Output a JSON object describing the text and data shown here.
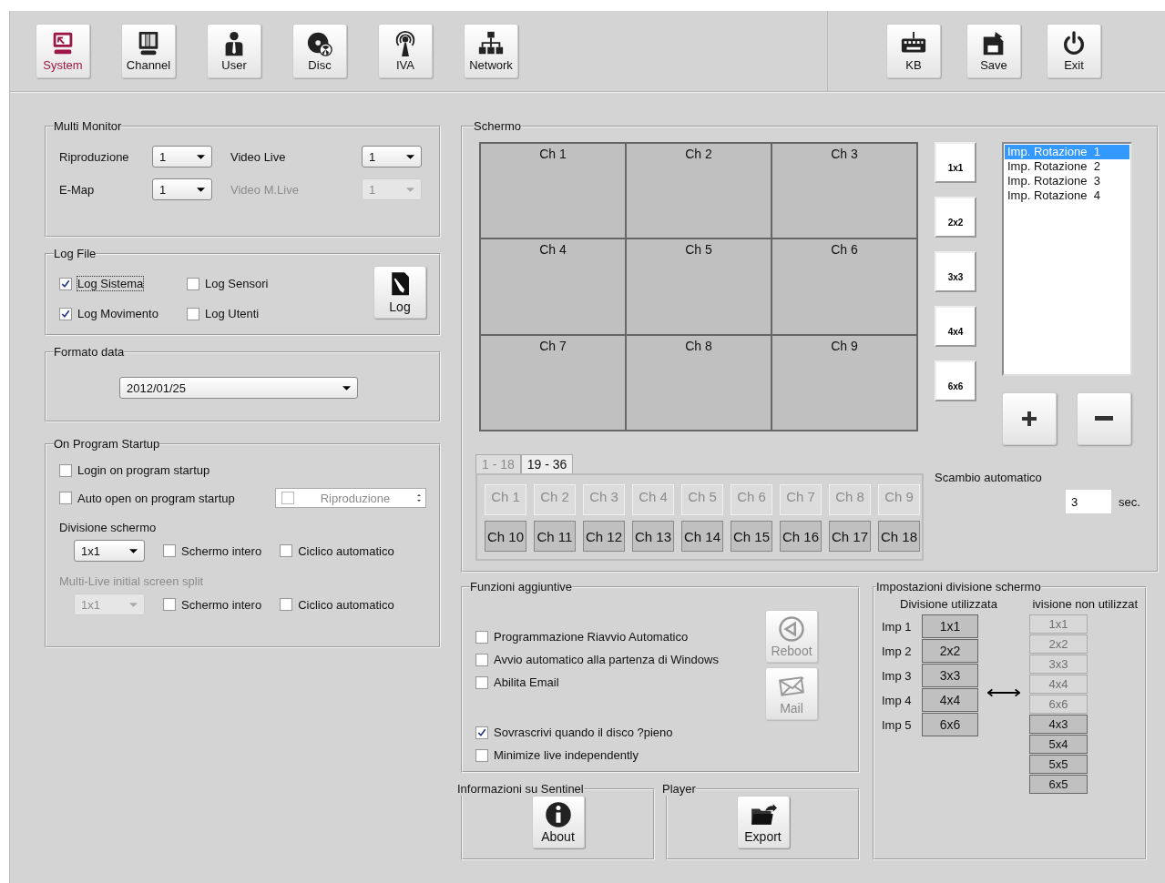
{
  "toolbar": {
    "left": [
      {
        "label": "System",
        "selected": true
      },
      {
        "label": "Channel",
        "selected": false
      },
      {
        "label": "User",
        "selected": false
      },
      {
        "label": "Disc",
        "selected": false
      },
      {
        "label": "IVA",
        "selected": false
      },
      {
        "label": "Network",
        "selected": false
      }
    ],
    "right": [
      {
        "label": "KB"
      },
      {
        "label": "Save"
      },
      {
        "label": "Exit"
      }
    ]
  },
  "multi_monitor": {
    "title": "Multi Monitor",
    "fields": [
      {
        "label": "Riproduzione",
        "value": "1",
        "disabled": false
      },
      {
        "label": "Video Live",
        "value": "1",
        "disabled": false
      },
      {
        "label": "E-Map",
        "value": "1",
        "disabled": false
      },
      {
        "label": "Video M.Live",
        "value": "1",
        "disabled": true
      }
    ]
  },
  "log_file": {
    "title": "Log File",
    "checkboxes": [
      {
        "label": "Log Sistema",
        "checked": true,
        "focused": true
      },
      {
        "label": "Log Sensori",
        "checked": false,
        "focused": false
      },
      {
        "label": "Log Movimento",
        "checked": true,
        "focused": false
      },
      {
        "label": "Log Utenti",
        "checked": false,
        "focused": false
      }
    ],
    "button": "Log"
  },
  "date_format": {
    "title": "Formato data",
    "value": "2012/01/25"
  },
  "startup": {
    "title": "On Program Startup",
    "login": {
      "label": "Login on program startup",
      "checked": false
    },
    "auto_open": {
      "label": "Auto open on program startup",
      "checked": false
    },
    "auto_open_target": {
      "value": "Riproduzione",
      "checked": false,
      "disabled": true
    },
    "split_sections": [
      {
        "label": "Divisione schermo",
        "disabled": false,
        "value": "1x1",
        "fullscreen": {
          "label": "Schermo intero",
          "checked": false
        },
        "cycle": {
          "label": "Ciclico automatico",
          "checked": false
        }
      },
      {
        "label": "Multi-Live initial screen split",
        "disabled": true,
        "value": "1x1",
        "fullscreen": {
          "label": "Schermo intero",
          "checked": false
        },
        "cycle": {
          "label": "Ciclico automatico",
          "checked": false
        }
      }
    ]
  },
  "screen": {
    "title": "Schermo",
    "cells": [
      "Ch 1",
      "Ch 2",
      "Ch 3",
      "Ch 4",
      "Ch 5",
      "Ch 6",
      "Ch 7",
      "Ch 8",
      "Ch 9"
    ],
    "layouts": [
      "1x1",
      "2x2",
      "3x3",
      "4x4",
      "6x6"
    ],
    "rotations": [
      {
        "label": "Imp. Rotazione  1",
        "selected": true
      },
      {
        "label": "Imp. Rotazione  2",
        "selected": false
      },
      {
        "label": "Imp. Rotazione  3",
        "selected": false
      },
      {
        "label": "Imp. Rotazione  4",
        "selected": false
      }
    ],
    "channel_tabs": [
      {
        "label": "1 - 18",
        "selected": false,
        "disabled": true
      },
      {
        "label": "19 - 36",
        "selected": true,
        "disabled": false
      }
    ],
    "channels": [
      {
        "label": "Ch 1",
        "disabled": true
      },
      {
        "label": "Ch 2",
        "disabled": true
      },
      {
        "label": "Ch 3",
        "disabled": true
      },
      {
        "label": "Ch 4",
        "disabled": true
      },
      {
        "label": "Ch 5",
        "disabled": true
      },
      {
        "label": "Ch 6",
        "disabled": true
      },
      {
        "label": "Ch 7",
        "disabled": true
      },
      {
        "label": "Ch 8",
        "disabled": true
      },
      {
        "label": "Ch 9",
        "disabled": true
      },
      {
        "label": "Ch 10",
        "disabled": false
      },
      {
        "label": "Ch 11",
        "disabled": false
      },
      {
        "label": "Ch 12",
        "disabled": false
      },
      {
        "label": "Ch 13",
        "disabled": false
      },
      {
        "label": "Ch 14",
        "disabled": false
      },
      {
        "label": "Ch 15",
        "disabled": false
      },
      {
        "label": "Ch 16",
        "disabled": false
      },
      {
        "label": "Ch 17",
        "disabled": false
      },
      {
        "label": "Ch 18",
        "disabled": false
      }
    ],
    "auto_switch": {
      "label": "Scambio automatico",
      "value": "3",
      "unit": "sec."
    }
  },
  "extra": {
    "title": "Funzioni aggiuntive",
    "checkboxes": [
      {
        "label": "Programmazione Riavvio Automatico",
        "checked": false
      },
      {
        "label": "Avvio automatico alla partenza di Windows",
        "checked": false
      },
      {
        "label": "Abilita Email",
        "checked": false
      },
      {
        "label": "Sovrascrivi quando il disco ?pieno",
        "checked": true
      },
      {
        "label": "Minimize live independently",
        "checked": false
      }
    ],
    "buttons": [
      {
        "label": "Reboot",
        "disabled": true
      },
      {
        "label": "Mail",
        "disabled": true
      }
    ]
  },
  "info": {
    "title": "Informazioni su Sentinel",
    "button": "About"
  },
  "player": {
    "title": "Player",
    "button": "Export"
  },
  "split_settings": {
    "title": "Impostazioni divisione schermo",
    "used_heading": "Divisione utilizzata",
    "unused_heading": "ivisione non utilizzat",
    "used": [
      {
        "label": "Imp 1",
        "value": "1x1"
      },
      {
        "label": "Imp 2",
        "value": "2x2"
      },
      {
        "label": "Imp 3",
        "value": "3x3"
      },
      {
        "label": "Imp 4",
        "value": "4x4"
      },
      {
        "label": "Imp 5",
        "value": "6x6"
      }
    ],
    "unused": [
      {
        "value": "1x1",
        "disabled": true
      },
      {
        "value": "2x2",
        "disabled": true
      },
      {
        "value": "3x3",
        "disabled": true
      },
      {
        "value": "4x4",
        "disabled": true
      },
      {
        "value": "6x6",
        "disabled": true
      },
      {
        "value": "4x3",
        "disabled": false
      },
      {
        "value": "5x4",
        "disabled": false
      },
      {
        "value": "5x5",
        "disabled": false
      },
      {
        "value": "6x5",
        "disabled": false
      }
    ]
  }
}
